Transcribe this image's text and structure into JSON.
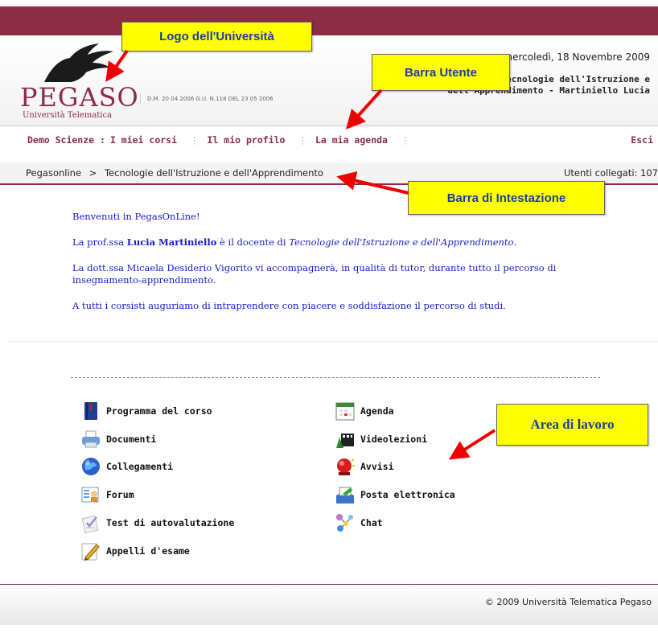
{
  "header": {
    "logo_text": "PEGASO",
    "logo_subtitle": "Università Telematica",
    "decree": "D.M. 20 04 2006 G.U. N.118 DEL 23 05 2006",
    "date": "mercoledì, 18 Novembre 2009",
    "course_line1": "Tecnologie dell'Istruzione e",
    "course_line2": "dell'Apprendimento - Martiniello Lucia"
  },
  "nav": {
    "context": "Demo Scienze :",
    "items": [
      "I miei corsi",
      "Il mio profilo",
      "La mia agenda"
    ],
    "logout": "Esci"
  },
  "breadcrumb": {
    "root": "Pegasonline",
    "separator": ">",
    "current": "Tecnologie dell'Istruzione e dell'Apprendimento",
    "users_online": "Utenti collegati: 107"
  },
  "welcome": {
    "p1": "Benvenuti in PegasOnLine!",
    "p2_pre": "La prof.ssa ",
    "p2_name": "Lucia Martiniello",
    "p2_mid": " è il docente di ",
    "p2_course": "Tecnologie dell'Istruzione e dell'Apprendimento",
    "p2_end": ".",
    "p3": "La dott.ssa Micaela Desiderio Vigorito vi accompagnerà, in qualità di tutor, durante tutto il percorso di insegnamento-apprendimento.",
    "p4": "A tutti i corsisti auguriamo di intraprendere con piacere e soddisfazione il percorso di studi."
  },
  "menu": {
    "left": [
      {
        "label": "Programma del corso",
        "icon": "book-icon"
      },
      {
        "label": "Documenti",
        "icon": "printer-icon"
      },
      {
        "label": "Collegamenti",
        "icon": "globe-icon"
      },
      {
        "label": "Forum",
        "icon": "forum-icon"
      },
      {
        "label": "Test di autovalutazione",
        "icon": "checklist-icon"
      },
      {
        "label": "Appelli d'esame",
        "icon": "pencil-icon"
      }
    ],
    "right": [
      {
        "label": "Agenda",
        "icon": "calendar-icon"
      },
      {
        "label": "Videolezioni",
        "icon": "film-icon"
      },
      {
        "label": "Avvisi",
        "icon": "alarm-icon"
      },
      {
        "label": "Posta elettronica",
        "icon": "mail-icon"
      },
      {
        "label": "Chat",
        "icon": "chat-icon"
      }
    ]
  },
  "footer": {
    "copyright": "© 2009 Università Telematica Pegaso"
  },
  "callouts": {
    "logo": "Logo dell'Università",
    "user_bar": "Barra Utente",
    "header_bar": "Barra di Intestazione",
    "work_area": "Area di lavoro"
  },
  "colors": {
    "brand": "#8c2c45",
    "link_blue": "#1a1acc",
    "callout_yellow": "#ffff00"
  }
}
